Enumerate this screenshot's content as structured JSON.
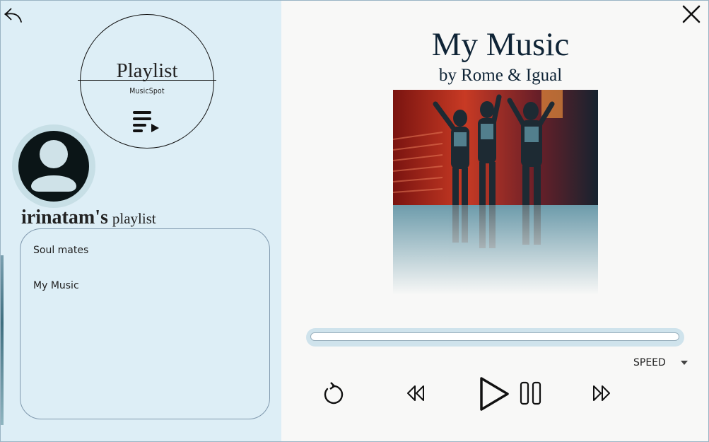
{
  "logo": {
    "title": "Playlist",
    "subtitle": "MusicSpot",
    "icon": "playlist-play-icon"
  },
  "user": {
    "name": "irinatam's",
    "suffix": "playlist"
  },
  "playlists": [
    {
      "label": "Soul mates"
    },
    {
      "label": "My Music"
    }
  ],
  "now_playing": {
    "title": "My Music",
    "artist": "by Rome & Igual"
  },
  "playback": {
    "progress": 0.0
  },
  "speed": {
    "label": "SPEED"
  },
  "icons": {
    "back": "undo-icon",
    "close": "close-icon",
    "replay": "replay-icon",
    "rewind": "rewind-icon",
    "play": "play-icon",
    "pause": "pause-icon",
    "forward": "fast-forward-icon"
  },
  "colors": {
    "left_panel": "#ddeef6",
    "background": "#f8f8f7",
    "title": "#0f2436",
    "border": "#7f98ad"
  }
}
